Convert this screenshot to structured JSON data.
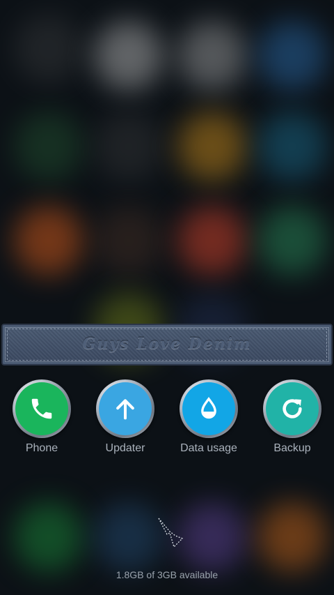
{
  "banner": {
    "title": "Guys Love Denim"
  },
  "apps": [
    {
      "label": "Phone",
      "color": "#1ab55c",
      "icon": "phone-icon"
    },
    {
      "label": "Updater",
      "color": "#3aa6e2",
      "icon": "arrow-up-icon"
    },
    {
      "label": "Data usage",
      "color": "#12a6e6",
      "icon": "water-drop-icon"
    },
    {
      "label": "Backup",
      "color": "#21b3a7",
      "icon": "refresh-icon"
    }
  ],
  "memory": {
    "text": "1.8GB of 3GB available"
  }
}
